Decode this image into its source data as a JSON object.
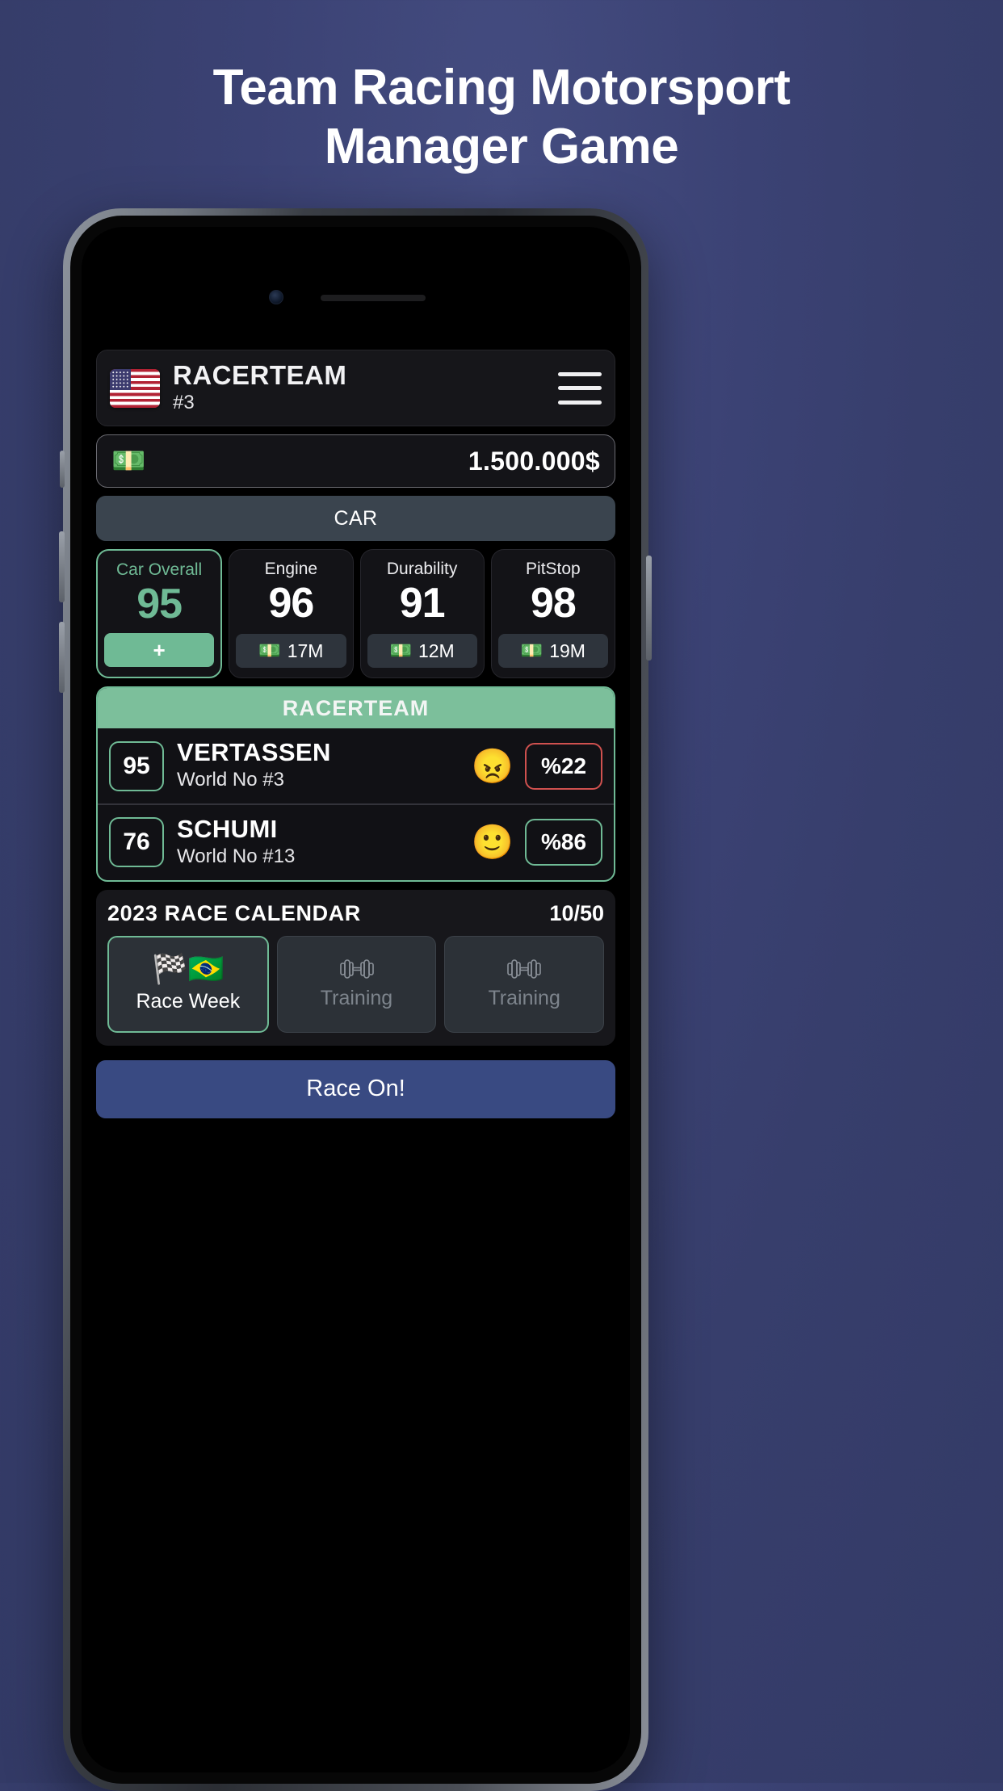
{
  "promo": {
    "line1": "Team Racing Motorsport",
    "line2": "Manager Game"
  },
  "app": {
    "header": {
      "flag_icon": "us-flag-icon",
      "team_name": "RACERTEAM",
      "team_rank": "#3",
      "menu_icon": "hamburger-menu-icon"
    },
    "money": {
      "icon": "💵",
      "amount": "1.500.000$"
    },
    "tabs": {
      "car_label": "CAR"
    },
    "stats": [
      {
        "label": "Car Overall",
        "value": "95",
        "action": "+",
        "primary": true
      },
      {
        "label": "Engine",
        "value": "96",
        "cost": "17M",
        "cost_icon": "💵"
      },
      {
        "label": "Durability",
        "value": "91",
        "cost": "12M",
        "cost_icon": "💵"
      },
      {
        "label": "PitStop",
        "value": "98",
        "cost": "19M",
        "cost_icon": "💵"
      }
    ],
    "drivers": {
      "title": "RACERTEAM",
      "rows": [
        {
          "overall": "95",
          "name": "VERTASSEN",
          "world": "World No #3",
          "mood_icon": "😠",
          "percent": "%22",
          "percent_state": "bad"
        },
        {
          "overall": "76",
          "name": "SCHUMI",
          "world": "World No #13",
          "mood_icon": "🙂",
          "percent": "%86",
          "percent_state": "good"
        }
      ]
    },
    "calendar": {
      "title": "2023 RACE CALENDAR",
      "count": "10/50",
      "items": [
        {
          "label": "Race Week",
          "icons": "🏁🇧🇷",
          "active": true
        },
        {
          "label": "Training",
          "icons": "dumbbell-icon",
          "active": false
        },
        {
          "label": "Training",
          "icons": "dumbbell-icon",
          "active": false
        }
      ]
    },
    "race_button": "Race On!"
  },
  "colors": {
    "accent_green": "#6fba95",
    "accent_blue": "#394a82",
    "bad_red": "#d0514f"
  }
}
